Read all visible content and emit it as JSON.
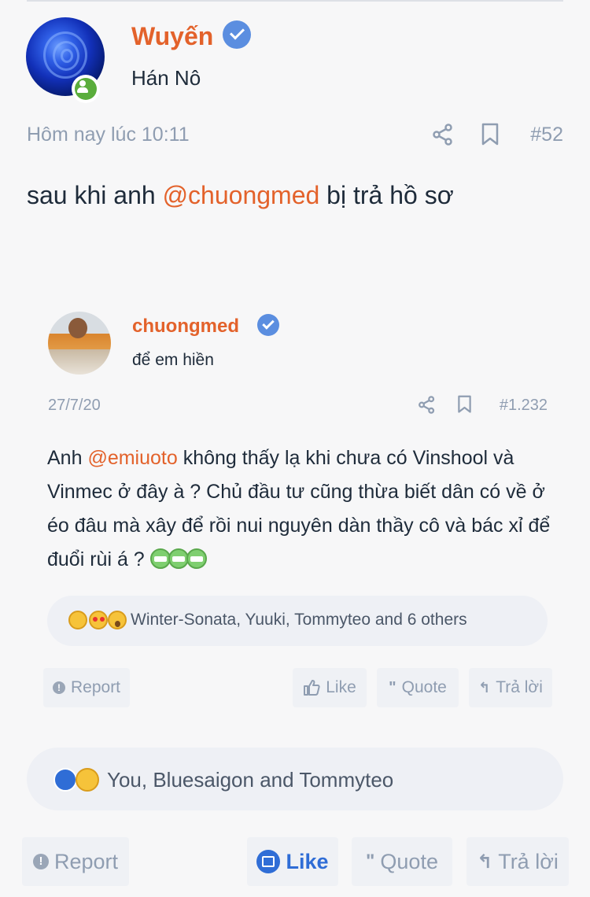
{
  "post": {
    "author": "Wuyến",
    "user_title": "Hán Nô",
    "timestamp": "Hôm nay lúc 10:11",
    "post_number": "#52",
    "text_before": "sau khi anh ",
    "mention": "@chuongmed",
    "text_after": " bị trả hồ sơ"
  },
  "quote": {
    "author": "chuongmed",
    "user_title": "để em hiền",
    "date": "27/7/20",
    "post_number": "#1.232",
    "body_prefix": "Anh ",
    "mention": "@emiuoto",
    "body_rest": " không thấy lạ khi chưa có Vinshool và Vinmec ở đây à ? Chủ đầu tư cũng thừa biết dân có về ở éo đâu mà xây để rồi nui nguyên dàn thầy cô và bác xỉ để đuổi rùi á ? ",
    "reactions_text": "Winter-Sonata, Yuuki, Tommyteo and 6 others",
    "actions": {
      "report": "Report",
      "like": "Like",
      "quote": "Quote",
      "reply": "Trả lời"
    }
  },
  "reactions_text": "You, Bluesaigon and Tommyteo",
  "actions": {
    "report": "Report",
    "like": "Like",
    "quote": "Quote",
    "reply": "Trả lời"
  },
  "colors": {
    "accent": "#e3622b",
    "verified": "#5b8ee0",
    "muted": "#8f9db1",
    "like_active": "#2f6dd6",
    "online": "#5aad3c"
  },
  "icons": [
    "verified-badge-icon",
    "online-status-icon",
    "share-icon",
    "bookmark-icon",
    "report-icon",
    "like-icon",
    "quote-icon",
    "reply-icon",
    "grin-emoji-icon",
    "laugh-emoji-icon",
    "heart-eyes-emoji-icon",
    "wow-emoji-icon"
  ]
}
